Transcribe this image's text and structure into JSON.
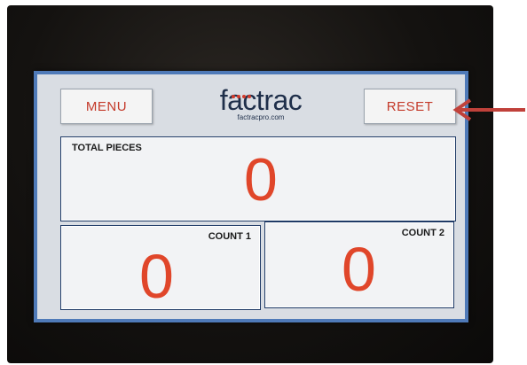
{
  "header": {
    "menu_label": "MENU",
    "reset_label": "RESET",
    "logo_text": "factrac",
    "logo_url": "factracpro.com"
  },
  "panels": {
    "total": {
      "label": "TOTAL PIECES",
      "value": "0"
    },
    "count1": {
      "label": "COUNT 1",
      "value": "0"
    },
    "count2": {
      "label": "COUNT 2",
      "value": "0"
    }
  },
  "colors": {
    "accent_red": "#e0462a",
    "button_text": "#c43a2a",
    "screen_border": "#4f7ab8",
    "panel_border": "#1f3a66",
    "arrow": "#c0413a"
  },
  "annotation": {
    "arrow_icon": "arrow-left-icon"
  }
}
